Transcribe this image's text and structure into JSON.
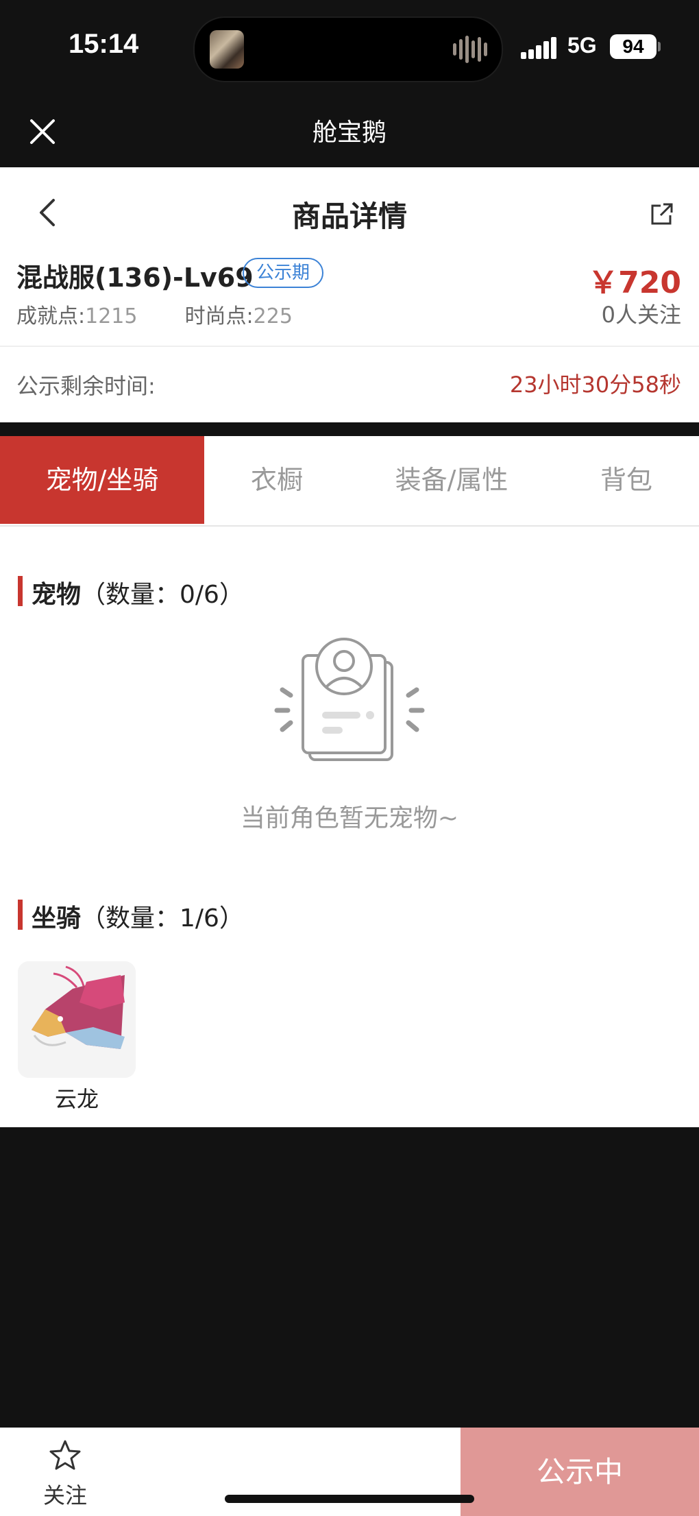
{
  "status_bar": {
    "time": "15:14",
    "network": "5G",
    "battery": "94"
  },
  "app_header": {
    "title": "舱宝鹅"
  },
  "page": {
    "title": "商品详情"
  },
  "product": {
    "name": "混战服(136)-Lv69",
    "badge": "公示期",
    "price": "￥720",
    "achievement_label": "成就点:",
    "achievement_value": "1215",
    "fashion_label": "时尚点:",
    "fashion_value": "225",
    "followers": "0人关注"
  },
  "timer": {
    "label": "公示剩余时间:",
    "value": "23小时30分58秒"
  },
  "tabs": [
    {
      "label": "宠物/坐骑",
      "active": true
    },
    {
      "label": "衣橱",
      "active": false
    },
    {
      "label": "装备/属性",
      "active": false
    },
    {
      "label": "背包",
      "active": false
    }
  ],
  "pets": {
    "title": "宠物",
    "count": "（数量：0/6）",
    "empty_text": "当前角色暂无宠物~"
  },
  "mounts": {
    "title": "坐骑",
    "count": "（数量：1/6）",
    "items": [
      {
        "name": "云龙"
      }
    ]
  },
  "bottom_bar": {
    "follow_label": "关注",
    "status_button": "公示中"
  },
  "colors": {
    "accent": "#c8362f",
    "badge_blue": "#3b82d6",
    "button_disabled": "#e09896"
  }
}
